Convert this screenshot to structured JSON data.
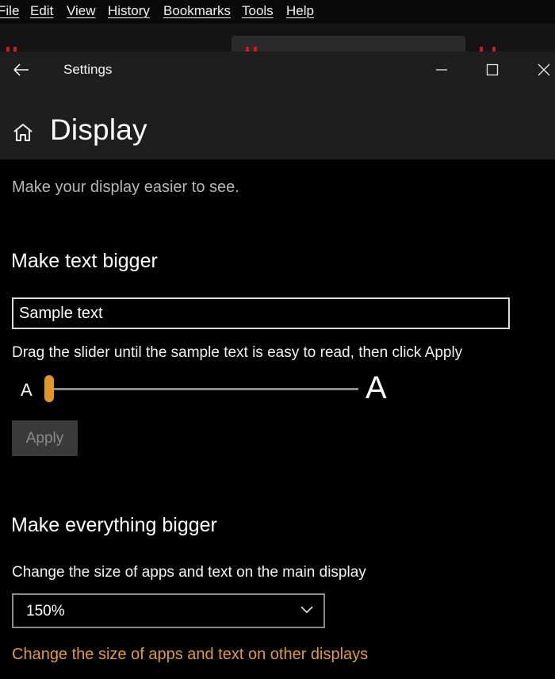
{
  "menubar": {
    "items": [
      "File",
      "Edit",
      "View",
      "History",
      "Bookmarks",
      "Tools",
      "Help"
    ]
  },
  "window": {
    "title": "Settings",
    "back_icon": "arrow-left-icon",
    "minimize_icon": "minimize-icon",
    "maximize_icon": "maximize-icon",
    "close_icon": "close-icon"
  },
  "page": {
    "home_icon": "home-icon",
    "title": "Display",
    "subtitle": "Make your display easier to see."
  },
  "text_size": {
    "heading": "Make text bigger",
    "sample_text": "Sample text",
    "hint": "Drag the slider until the sample text is easy to read, then click Apply",
    "slider_min_label": "A",
    "slider_max_label": "A",
    "slider_value_fraction": 0.0,
    "apply_label": "Apply",
    "apply_enabled": false
  },
  "scale": {
    "heading": "Make everything bigger",
    "description": "Change the size of apps and text on the main display",
    "selected": "150%",
    "other_displays_link": "Change the size of apps and text on other displays"
  },
  "colors": {
    "accent": "#e39a3a",
    "titlebar": "#1e1e1e",
    "background": "#000000",
    "disabled_button": "#3a3a3a"
  }
}
